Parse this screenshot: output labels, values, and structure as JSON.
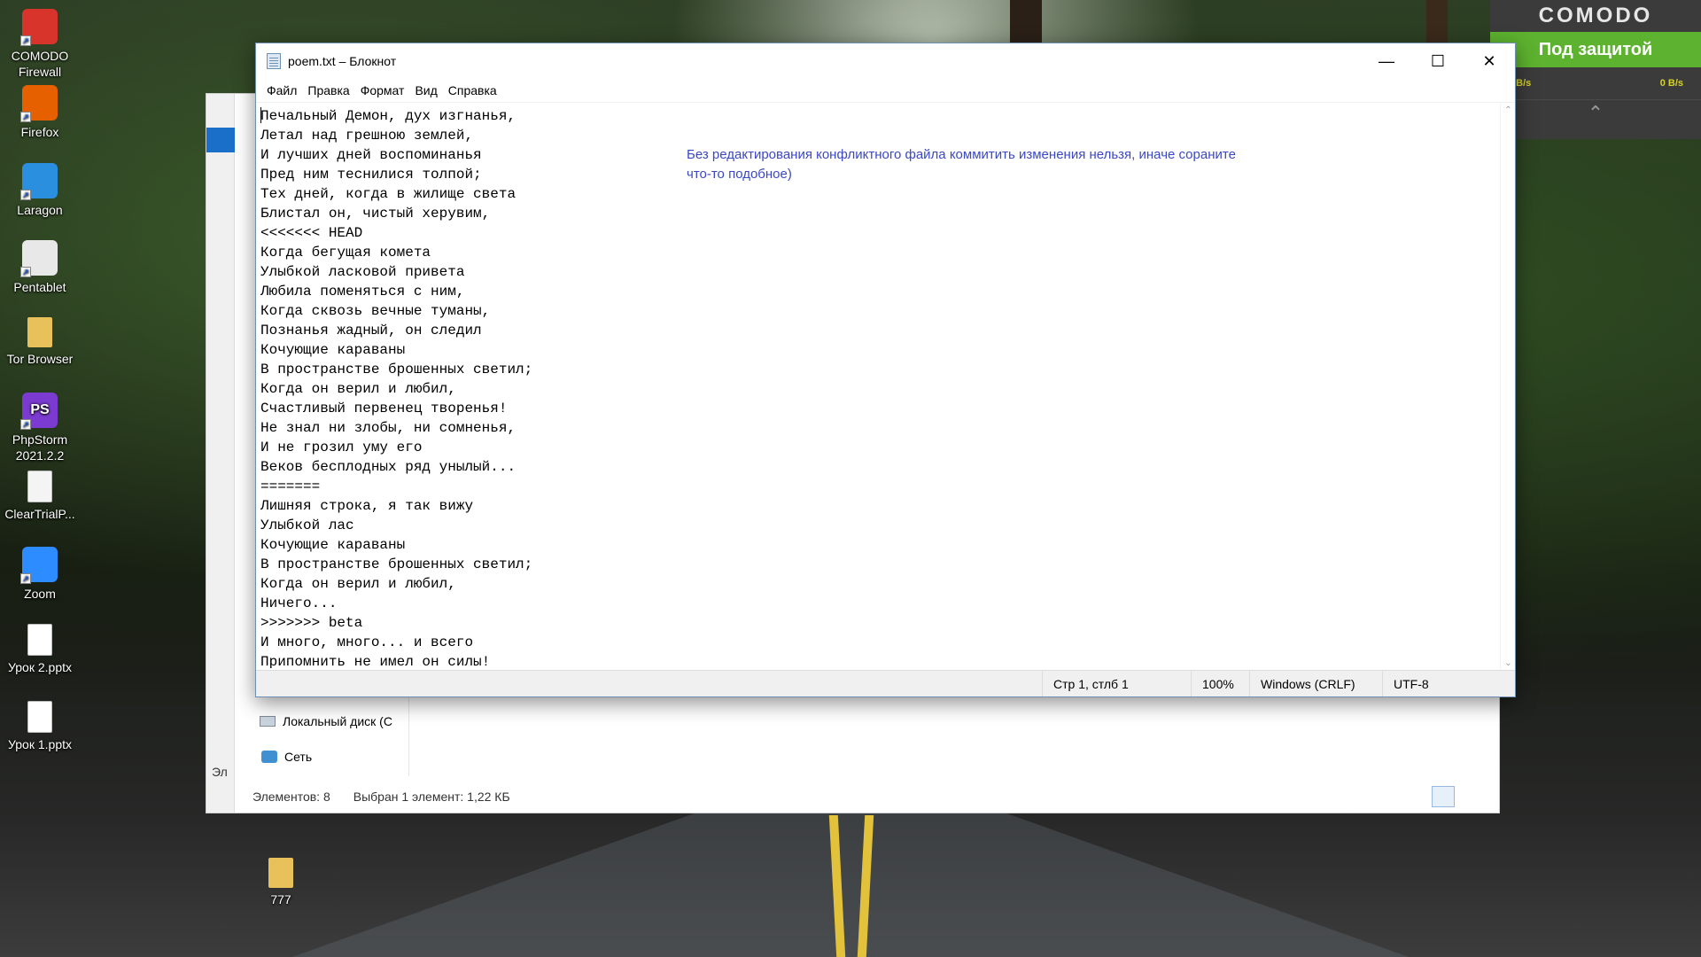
{
  "desktop": {
    "icons": [
      {
        "label": "COMODO Firewall",
        "icon": "comodo-firewall-icon",
        "color": "#d9342b"
      },
      {
        "label": "Firefox",
        "icon": "firefox-icon",
        "color": "#e66000"
      },
      {
        "label": "Laragon",
        "icon": "laragon-icon",
        "color": "#2b8fe0"
      },
      {
        "label": "Pentablet",
        "icon": "pentablet-icon",
        "color": "#e8e8e8"
      },
      {
        "label": "Tor Browser",
        "icon": "folder-icon",
        "color": "#e8c15a"
      },
      {
        "label": "PhpStorm 2021.2.2",
        "icon": "phpstorm-icon",
        "color": "#7b3bd0",
        "text": "PS"
      },
      {
        "label": "ClearTrialP...",
        "icon": "document-icon",
        "color": "#f4f4f4"
      },
      {
        "label": "Zoom",
        "icon": "zoom-icon",
        "color": "#2d8cff"
      },
      {
        "label": "Урок 2.pptx",
        "icon": "document-icon",
        "color": "#ffffff"
      },
      {
        "label": "Урок 1.pptx",
        "icon": "document-icon",
        "color": "#ffffff"
      }
    ],
    "folder_777": "777"
  },
  "comodo": {
    "title": "COMODO",
    "status": "Под защитой",
    "speed_left": "0 B/s",
    "speed_right": "0 B/s",
    "accent": "#5db22f"
  },
  "explorer": {
    "nav_local_disk": "Локальный диск (C",
    "nav_network": "Сеть",
    "status_items": "Элементов: 8",
    "status_selected": "Выбран 1 элемент: 1,22 КБ",
    "stub_text": "Эл"
  },
  "notepad": {
    "title": "poem.txt – Блокнот",
    "menu": [
      "Файл",
      "Правка",
      "Формат",
      "Вид",
      "Справка"
    ],
    "lines": [
      "Печальный Демон, дух изгнанья,",
      "Летал над грешною землей,",
      "И лучших дней воспоминанья",
      "Пред ним теснилися толпой;",
      "Тех дней, когда в жилище света",
      "Блистал он, чистый херувим,",
      "<<<<<<< HEAD",
      "Когда бегущая комета",
      "Улыбкой ласковой привета",
      "Любила поменяться с ним,",
      "Когда сквозь вечные туманы,",
      "Познанья жадный, он следил",
      "Кочующие караваны",
      "В пространстве брошенных светил;",
      "Когда он верил и любил,",
      "Счастливый первенец творенья!",
      "Не знал ни злобы, ни сомненья,",
      "И не грозил уму его",
      "Веков бесплодных ряд унылый...",
      "=======",
      "Лишняя строка, я так вижу",
      "Улыбкой лас",
      "Кочующие караваны",
      "В пространстве брошенных светил;",
      "Когда он верил и любил,",
      "Ничего...",
      ">>>>>>> beta",
      "И много, много... и всего",
      "Припомнить не имел он силы!"
    ],
    "note": "Без редактирования конфликтного файла коммитить изменения нельзя, иначе сорaните что-то подобное)",
    "status": {
      "position": "Стр 1, стлб 1",
      "zoom": "100%",
      "line_endings": "Windows (CRLF)",
      "encoding": "UTF-8"
    }
  }
}
